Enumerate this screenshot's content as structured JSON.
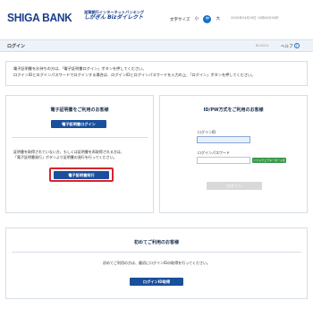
{
  "header": {
    "bank_name": "SHIGA BANK",
    "subbrand_top": "滋賀銀行インターネットバンキング",
    "subbrand_bottom": "しがぎん Bizダイレクト",
    "font_size_label": "文字サイズ",
    "font_size_small": "小",
    "font_size_medium": "中",
    "font_size_large": "大",
    "datetime": "20XX年04月18日 10時00分00秒"
  },
  "titlebar": {
    "title": "ログイン",
    "screen_id": "BLGI001",
    "help_label": "ヘルプ"
  },
  "notice": {
    "line1": "電子証明書をお持ちの方は、「電子証明書ログイン」ボタンを押してください。",
    "line2": "ログインIDとログインパスワードでログインする場合は、ログインIDとログインパスワードを入力の上、「ログイン」ボタンを押してください。"
  },
  "cert_panel": {
    "title": "電子証明書をご利用のお客様",
    "login_button": "電子証明書ログイン",
    "desc_line1": "証明書を取得されていない方、もしくは証明書を再取得される方は、",
    "desc_line2": "「電子証明書発行」ボタンより証明書の発行を行ってください。",
    "issue_button": "電子証明書発行"
  },
  "idpw_panel": {
    "title": "ID/PW方式をご利用のお客様",
    "id_label": "ログインID",
    "id_value": "",
    "pw_label": "ログインパスワード",
    "pw_value": "",
    "keyboard_button": "ソフトウェアキーボードを開く",
    "login_button": "ログイン"
  },
  "first_panel": {
    "title": "初めてご利用のお客様",
    "desc": "初めてご利用の方は、最初にログインIDの取得を行ってください。",
    "button": "ログインID取得"
  },
  "colors": {
    "brand": "#1a3e8c",
    "button": "#1a4f9c",
    "highlight": "#d9232d",
    "keyboard": "#3a9a4a"
  }
}
